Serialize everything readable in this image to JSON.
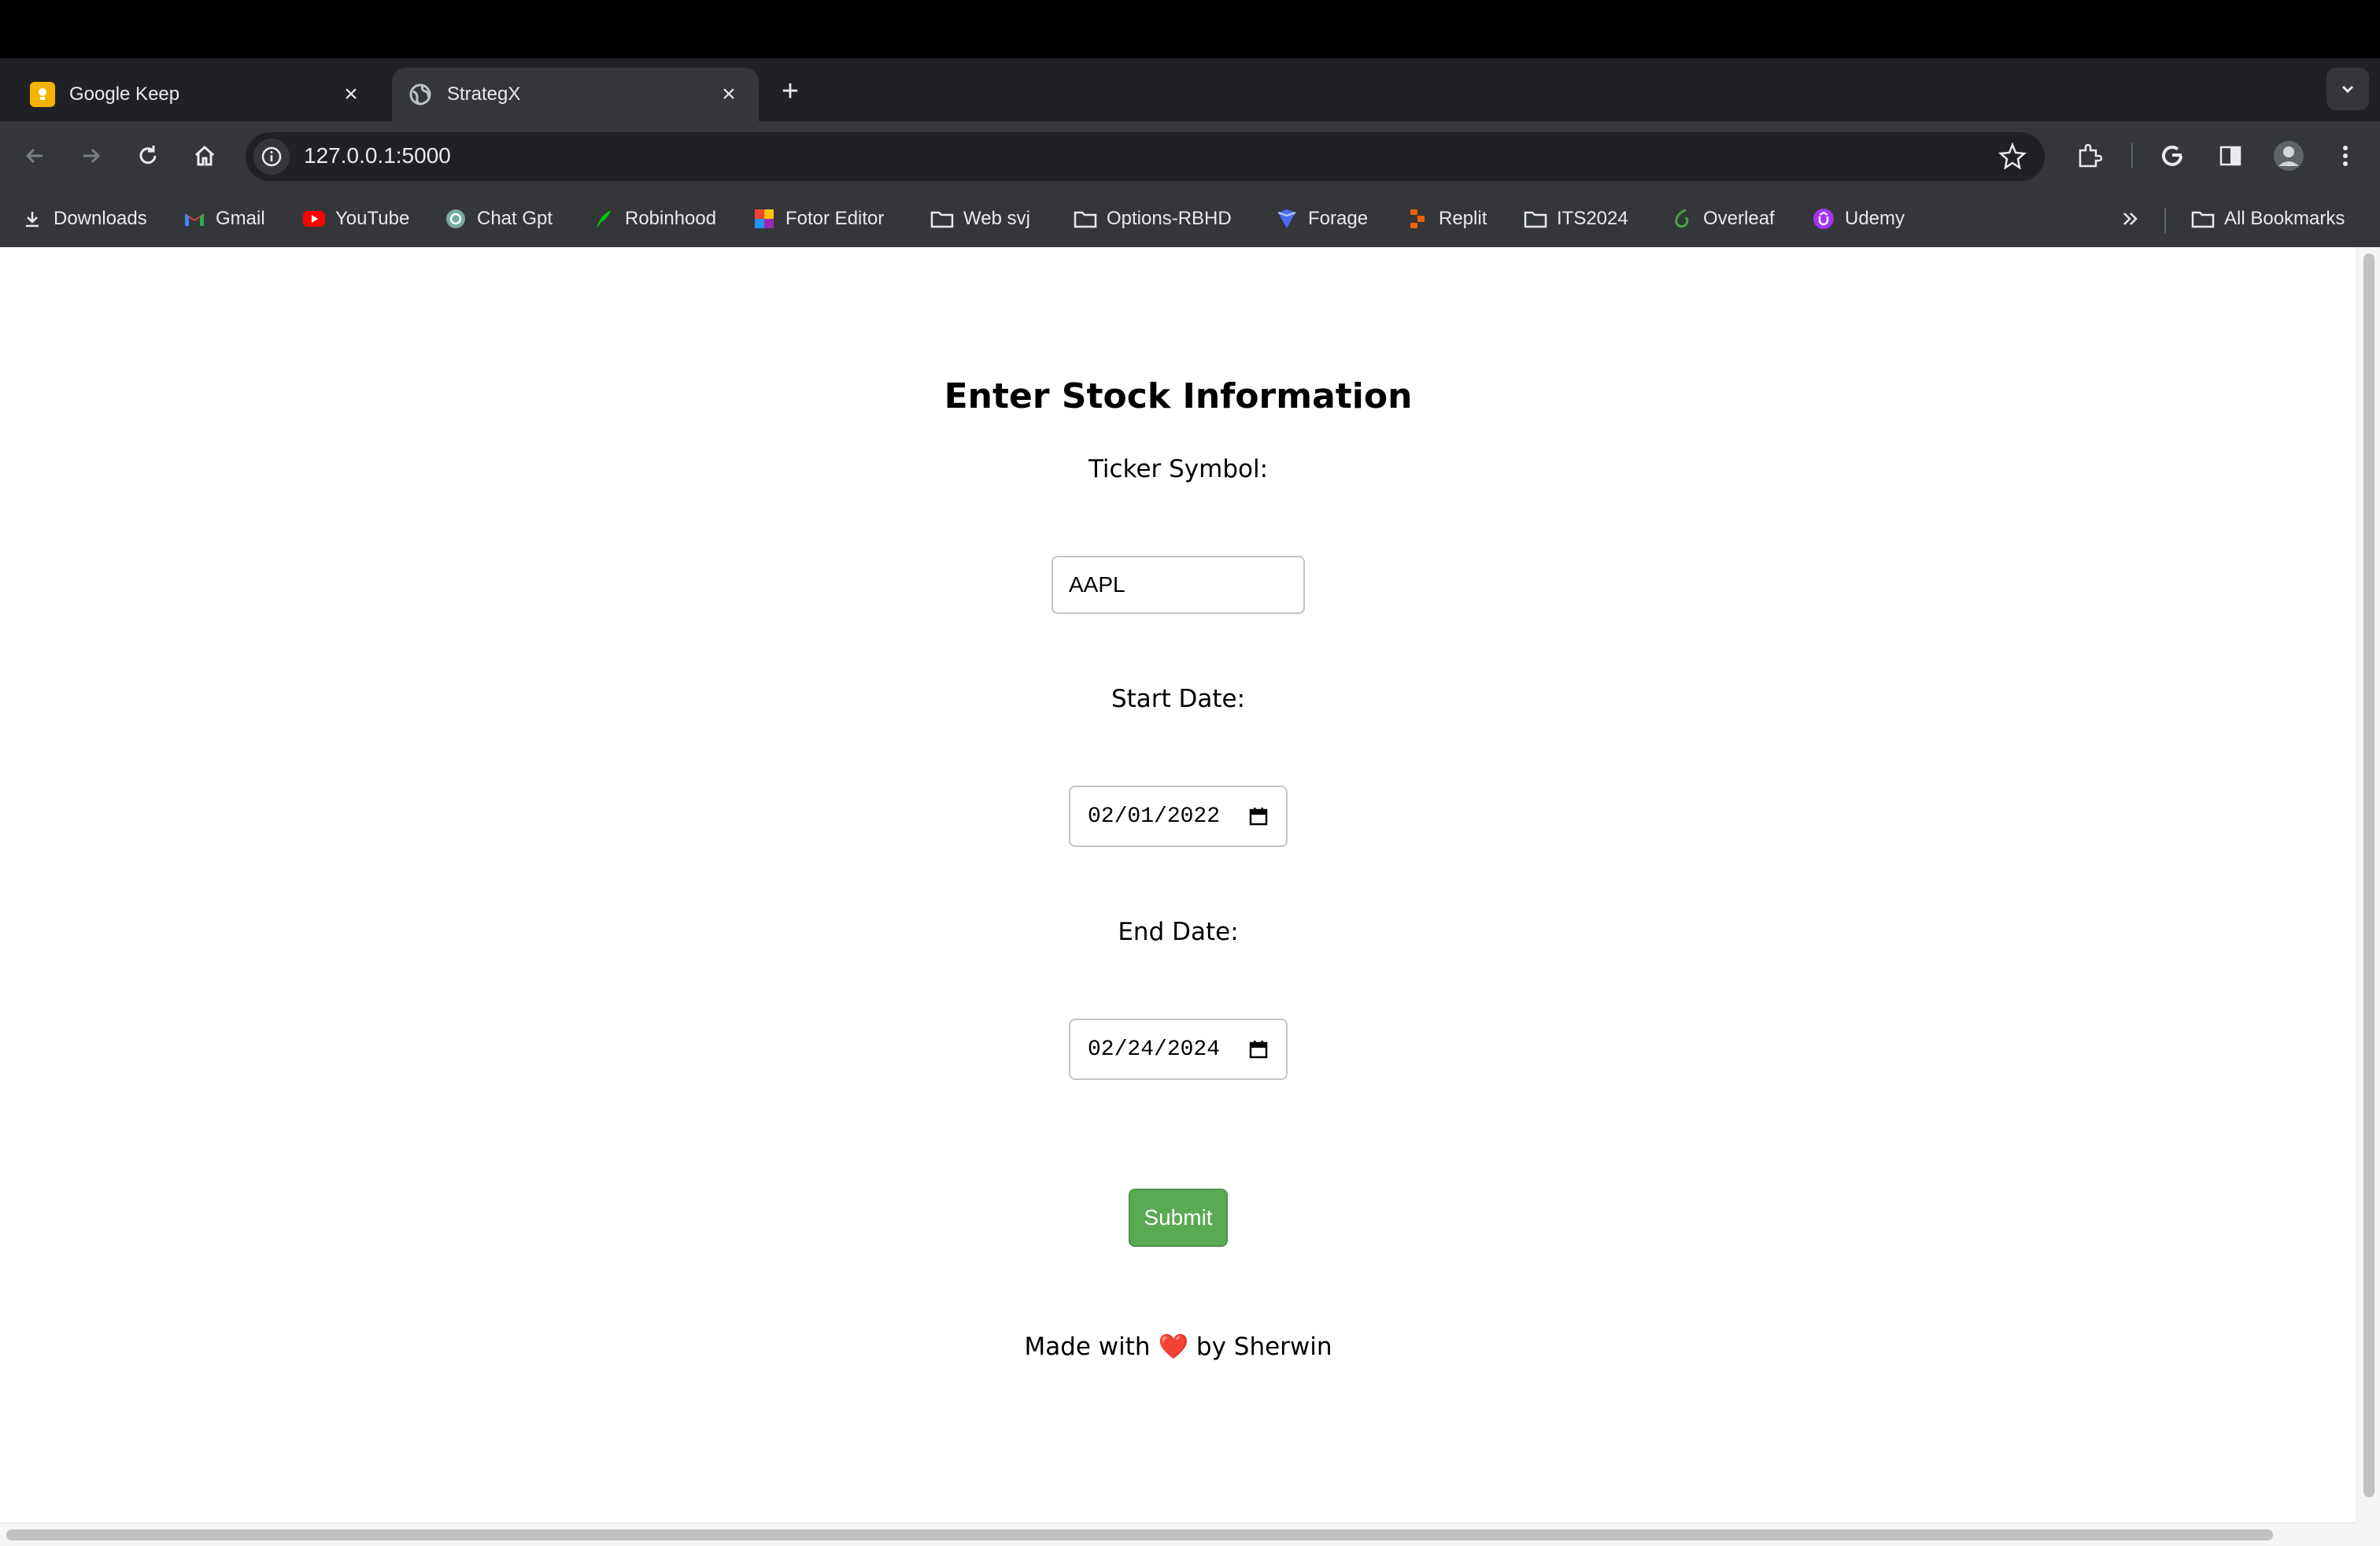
{
  "tabs": [
    {
      "title": "Google Keep",
      "icon": "google-keep-icon"
    },
    {
      "title": "StrategX",
      "icon": "globe-icon"
    }
  ],
  "omnibox": {
    "url": "127.0.0.1:5000"
  },
  "bookmarks": [
    {
      "label": "Downloads",
      "icon": "download-icon"
    },
    {
      "label": "Gmail",
      "icon": "gmail-icon"
    },
    {
      "label": "YouTube",
      "icon": "youtube-icon"
    },
    {
      "label": "Chat Gpt",
      "icon": "chatgpt-icon"
    },
    {
      "label": "Robinhood",
      "icon": "robinhood-icon"
    },
    {
      "label": "Fotor Editor",
      "icon": "fotor-icon"
    },
    {
      "label": "Web svj",
      "icon": "folder-icon"
    },
    {
      "label": "Options-RBHD",
      "icon": "folder-icon"
    },
    {
      "label": "Forage",
      "icon": "forage-icon"
    },
    {
      "label": "Replit",
      "icon": "replit-icon"
    },
    {
      "label": "ITS2024",
      "icon": "folder-icon"
    },
    {
      "label": "Overleaf",
      "icon": "overleaf-icon"
    },
    {
      "label": "Udemy",
      "icon": "udemy-icon"
    }
  ],
  "all_bookmarks": {
    "label": "All Bookmarks"
  },
  "form": {
    "heading": "Enter Stock Information",
    "ticker_label": "Ticker Symbol:",
    "ticker_value": "AAPL",
    "start_label": "Start Date:",
    "start_value": "02/01/2022",
    "end_label": "End Date:",
    "end_value": "02/24/2024",
    "submit_label": "Submit"
  },
  "footer": {
    "prefix": "Made with",
    "heart": "❤️",
    "suffix": "by Sherwin"
  },
  "colors": {
    "submit": "#5aaa54",
    "browser_chrome": "#35363a",
    "tab_strip": "#202124"
  }
}
